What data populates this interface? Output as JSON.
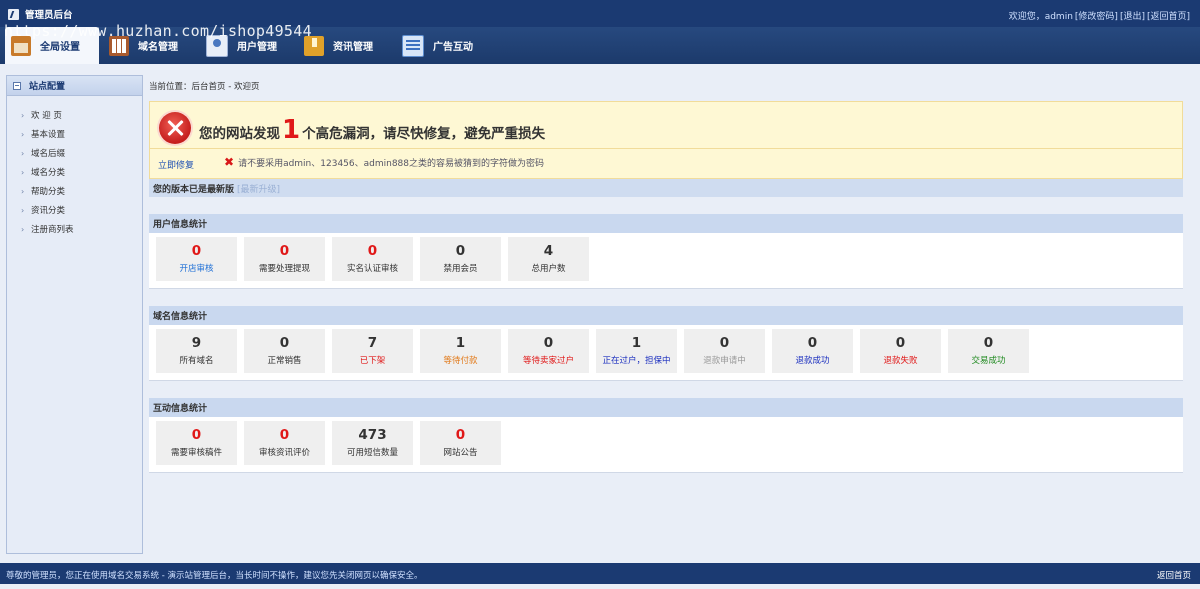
{
  "app": {
    "title": "管理员后台",
    "watermark": "https://www.huzhan.com/ishop49544"
  },
  "top_links": {
    "welcome": "欢迎您，admin",
    "change_password": "[修改密码]",
    "logout": "[退出]",
    "home": "[返回首页]"
  },
  "nav": [
    {
      "label": "全局设置",
      "icon": "settings-icon",
      "active": true
    },
    {
      "label": "域名管理",
      "icon": "domain-icon"
    },
    {
      "label": "用户管理",
      "icon": "user-icon"
    },
    {
      "label": "资讯管理",
      "icon": "news-icon"
    },
    {
      "label": "广告互动",
      "icon": "ad-icon"
    }
  ],
  "sidebar": {
    "title": "站点配置",
    "items": [
      "欢 迎 页",
      "基本设置",
      "域名后缀",
      "域名分类",
      "帮助分类",
      "资讯分类",
      "注册商列表"
    ]
  },
  "breadcrumb": "当前位置：后台首页 - 欢迎页",
  "alert": {
    "prefix": "您的网站发现",
    "count": "1",
    "suffix": "个高危漏洞，请尽快修复，避免严重损失",
    "fix_link": "立即修复",
    "warning": "请不要采用admin、123456、admin888之类的容易被猜到的字符做为密码"
  },
  "version": {
    "text": "您的版本已是最新版",
    "upgrade": "[最新升级]"
  },
  "panels": [
    {
      "title": "用户信息统计",
      "stats": [
        {
          "value": "0",
          "label": "开店审核",
          "value_color": "#e01818",
          "label_color": "#1e6fd6"
        },
        {
          "value": "0",
          "label": "需要处理提现",
          "value_color": "#e01818",
          "label_color": "#333333"
        },
        {
          "value": "0",
          "label": "实名认证审核",
          "value_color": "#e01818",
          "label_color": "#333333"
        },
        {
          "value": "0",
          "label": "禁用会员",
          "value_color": "#333333",
          "label_color": "#333333"
        },
        {
          "value": "4",
          "label": "总用户数",
          "value_color": "#333333",
          "label_color": "#333333"
        }
      ]
    },
    {
      "title": "域名信息统计",
      "stats": [
        {
          "value": "9",
          "label": "所有域名",
          "value_color": "#333333",
          "label_color": "#333333"
        },
        {
          "value": "0",
          "label": "正常销售",
          "value_color": "#333333",
          "label_color": "#333333"
        },
        {
          "value": "7",
          "label": "已下架",
          "value_color": "#333333",
          "label_color": "#e01818"
        },
        {
          "value": "1",
          "label": "等待付款",
          "value_color": "#333333",
          "label_color": "#e27a1a"
        },
        {
          "value": "0",
          "label": "等待卖家过户",
          "value_color": "#333333",
          "label_color": "#e01818"
        },
        {
          "value": "1",
          "label": "正在过户，担保中",
          "value_color": "#333333",
          "label_color": "#1b2fbf"
        },
        {
          "value": "0",
          "label": "退款申请中",
          "value_color": "#333333",
          "label_color": "#999999"
        },
        {
          "value": "0",
          "label": "退款成功",
          "value_color": "#333333",
          "label_color": "#1b2fbf"
        },
        {
          "value": "0",
          "label": "退款失败",
          "value_color": "#333333",
          "label_color": "#e01818"
        },
        {
          "value": "0",
          "label": "交易成功",
          "value_color": "#333333",
          "label_color": "#1f8a1f"
        }
      ]
    },
    {
      "title": "互动信息统计",
      "stats": [
        {
          "value": "0",
          "label": "需要审核稿件",
          "value_color": "#e01818",
          "label_color": "#333333"
        },
        {
          "value": "0",
          "label": "审核资讯评价",
          "value_color": "#e01818",
          "label_color": "#333333"
        },
        {
          "value": "473",
          "label": "可用短信数量",
          "value_color": "#333333",
          "label_color": "#333333"
        },
        {
          "value": "0",
          "label": "网站公告",
          "value_color": "#e01818",
          "label_color": "#333333"
        }
      ]
    }
  ],
  "footer": {
    "notice": "尊敬的管理员，您正在使用域名交易系统 - 演示站管理后台，当长时间不操作，建议您先关闭网页以确保安全。",
    "back": "返回首页"
  }
}
